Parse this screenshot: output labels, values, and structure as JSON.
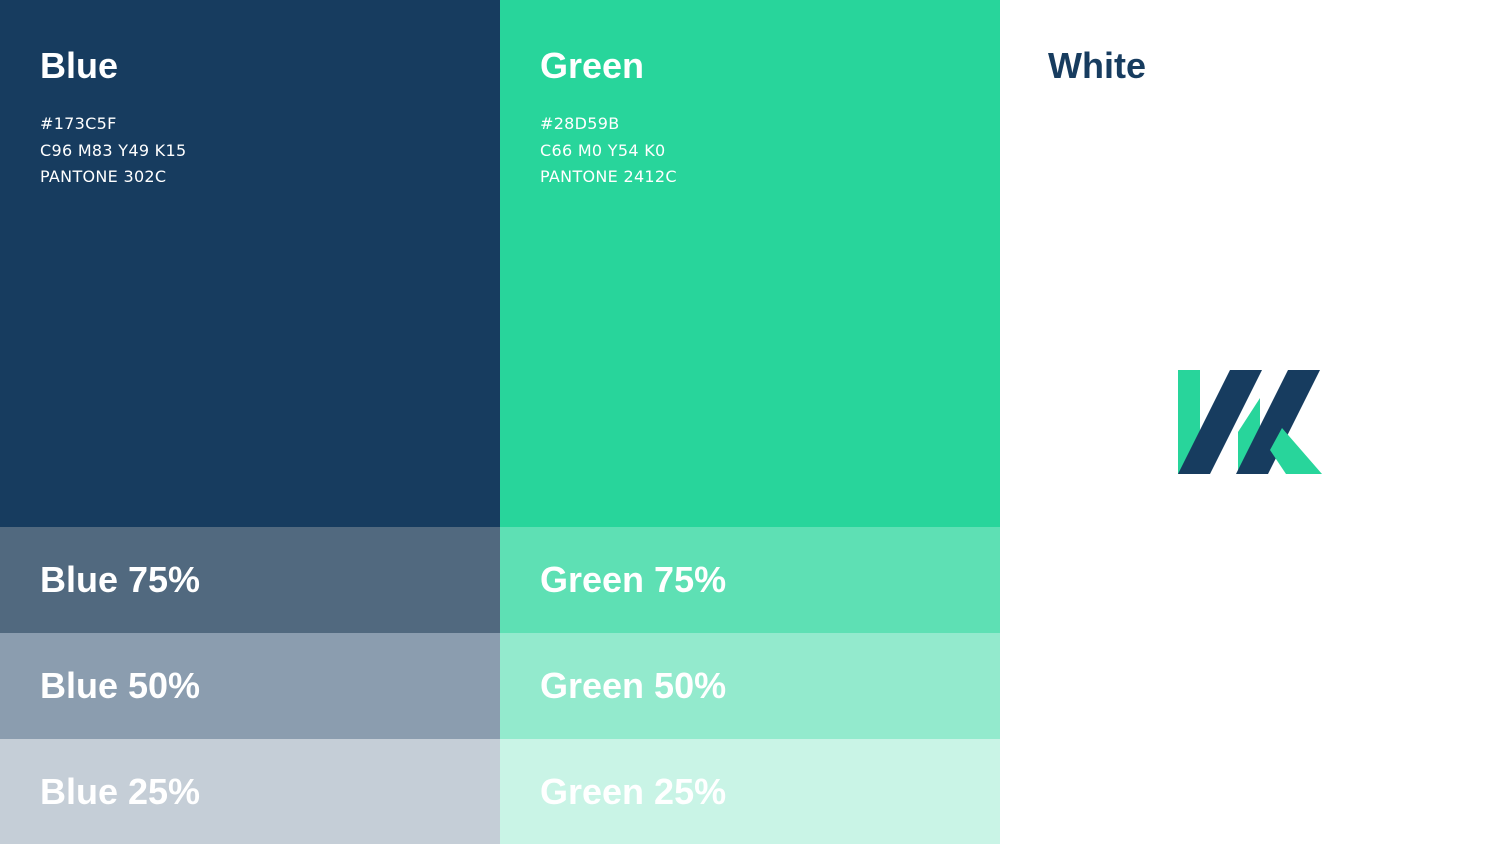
{
  "blue": {
    "name": "Blue",
    "hex": "#173C5F",
    "cmyk": "C96 M83 Y49 K15",
    "pantone": "PANTONE 302C",
    "color": "#173c5f",
    "tints": [
      {
        "label": "Blue 75%",
        "color": "#51697f"
      },
      {
        "label": "Blue 50%",
        "color": "#8b9daf"
      },
      {
        "label": "Blue 25%",
        "color": "#c5ced7"
      }
    ]
  },
  "green": {
    "name": "Green",
    "hex": "#28D59B",
    "cmyk": "C66 M0 Y54 K0",
    "pantone": "PANTONE 2412C",
    "color": "#28d59b",
    "tints": [
      {
        "label": "Green 75%",
        "color": "#5ee0b4"
      },
      {
        "label": "Green 50%",
        "color": "#93eacd"
      },
      {
        "label": "Green 25%",
        "color": "#c9f4e6"
      }
    ]
  },
  "white": {
    "name": "White",
    "color": "#ffffff",
    "logo_icon": "brand-monogram-icon"
  }
}
